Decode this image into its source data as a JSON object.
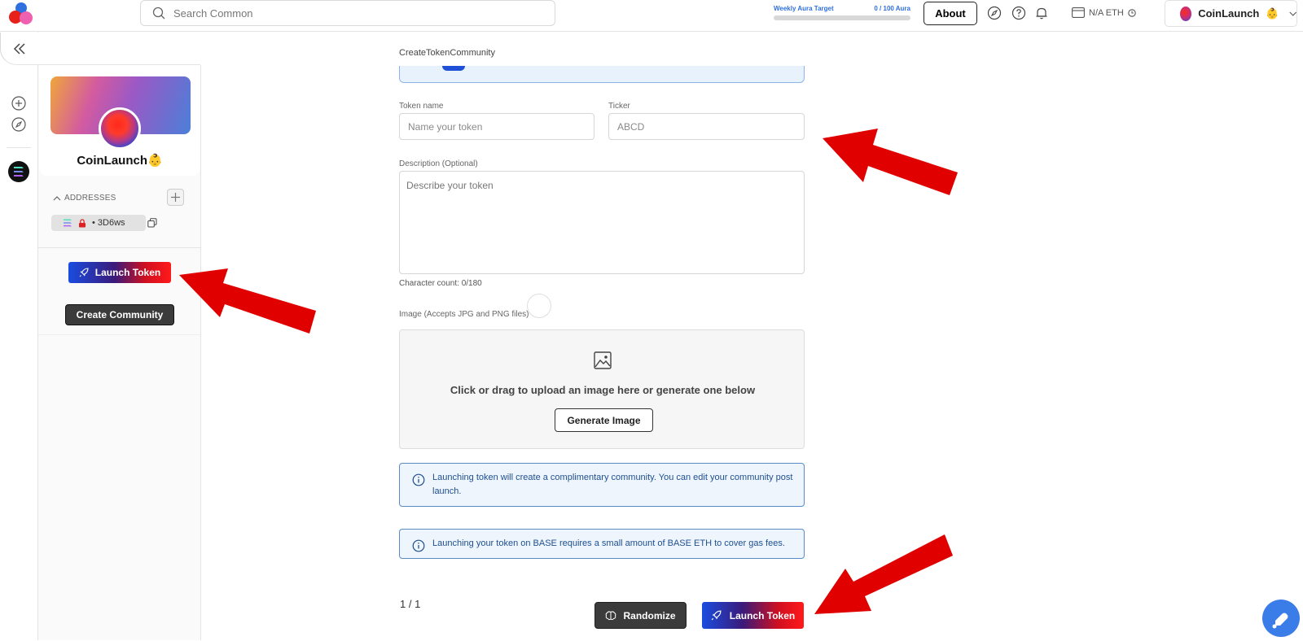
{
  "header": {
    "search_placeholder": "Search Common",
    "aura_label": "Weekly Aura Target",
    "aura_value": "0 / 100 Aura",
    "aura_progress": 0,
    "about_label": "About",
    "wallet_label": "N/A ETH",
    "user_name": "CoinLaunch",
    "user_emoji": "👶"
  },
  "sidebar": {
    "profile_name": "CoinLaunch👶",
    "addresses_label": "ADDRESSES",
    "address_short": "• 3D6ws",
    "launch_token_label": "Launch Token",
    "create_community_label": "Create Community"
  },
  "form": {
    "page_title": "CreateTokenCommunity",
    "token_name_label": "Token name",
    "token_name_placeholder": "Name your token",
    "ticker_label": "Ticker",
    "ticker_placeholder": "ABCD",
    "description_label": "Description (Optional)",
    "description_placeholder": "Describe your token",
    "char_count": "Character count: 0/180",
    "image_label": "Image (Accepts JPG and PNG files)",
    "upload_text": "Click or drag to upload an image here or generate one below",
    "generate_label": "Generate Image",
    "info_1": "Launching token will create a complimentary community. You can edit your community post launch.",
    "info_2": "Launching your token on BASE requires a small amount of BASE ETH to cover gas fees.",
    "pager": "1 / 1",
    "randomize_label": "Randomize",
    "launch_label": "Launch Token"
  },
  "colors": {
    "accent_blue": "#2f6fe0",
    "annotation_red": "#e00000",
    "info_bg": "#eef5fd"
  }
}
